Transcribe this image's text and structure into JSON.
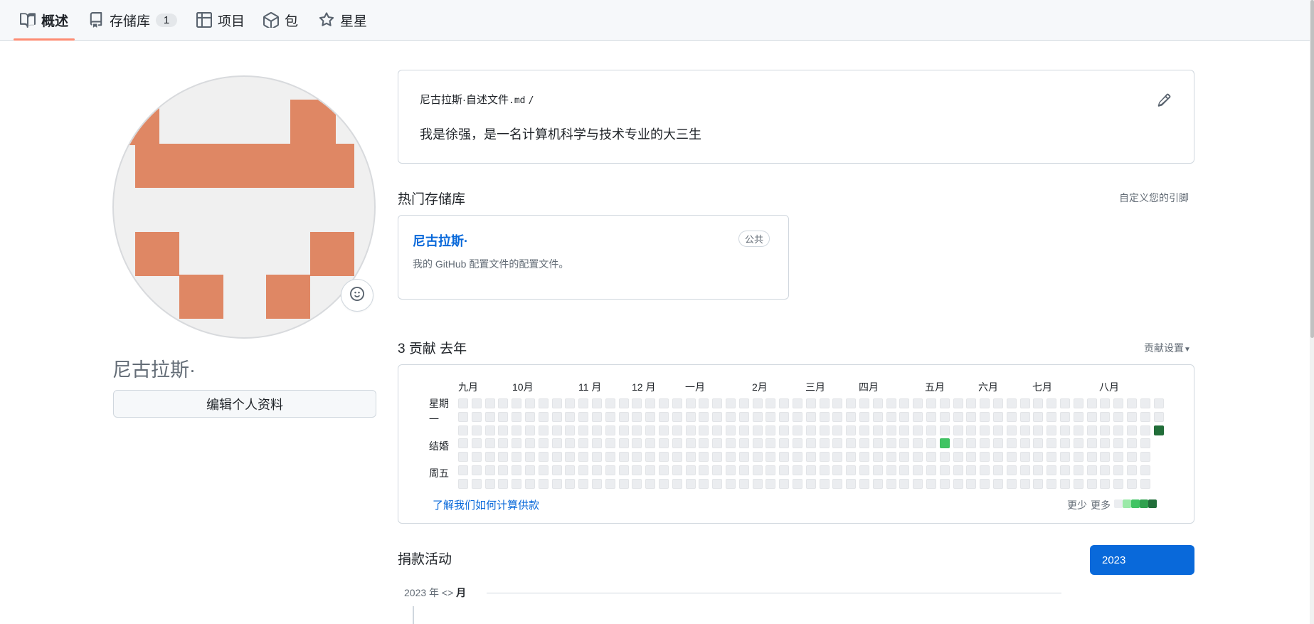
{
  "nav": {
    "tabs": [
      {
        "label": "概述",
        "icon": "book-icon",
        "active": true
      },
      {
        "label": "存储库",
        "icon": "repo-icon",
        "count": "1"
      },
      {
        "label": "项目",
        "icon": "table-icon"
      },
      {
        "label": "包",
        "icon": "package-icon"
      },
      {
        "label": "星星",
        "icon": "star-icon"
      }
    ]
  },
  "profile": {
    "name": "尼古拉斯·",
    "edit_button": "编辑个人资料",
    "avatar_color": "#df8764"
  },
  "readme": {
    "path_name": "尼古拉斯·自述文件",
    "path_ext": ".md",
    "path_sep": "/",
    "text": "我是徐强，是一名计算机科学与技术专业的大三生"
  },
  "popular": {
    "title": "热门存储库",
    "customize_link": "自定义您的引脚",
    "repo": {
      "name": "尼古拉斯·",
      "badge": "公共",
      "description": "我的 GitHub 配置文件的配置文件。"
    }
  },
  "contributions": {
    "title": "3 贡献 去年",
    "settings_link": "贡献设置",
    "months": [
      "九月",
      "10月",
      "11 月",
      "12 月",
      "一月",
      "2月",
      "三月",
      "四月",
      "五月",
      "六月",
      "七月",
      "八月"
    ],
    "day_labels": [
      "星期",
      "一",
      "结婚",
      "周五"
    ],
    "learn_link": "了解我们如何计算供款",
    "legend_less": "更少",
    "legend_more": "更多",
    "weeks": 53,
    "active_days": [
      {
        "week": 36,
        "day": 3,
        "level": 2
      },
      {
        "week": 52,
        "day": 2,
        "level": 4
      }
    ],
    "level_colors": [
      "#ebedf0",
      "#9be9a8",
      "#40c463",
      "#30a14e",
      "#216e39"
    ]
  },
  "activity": {
    "title": "捐款活动",
    "year_button": "2023",
    "timeline_prefix": "2023 年 <>",
    "timeline_month": "月"
  }
}
